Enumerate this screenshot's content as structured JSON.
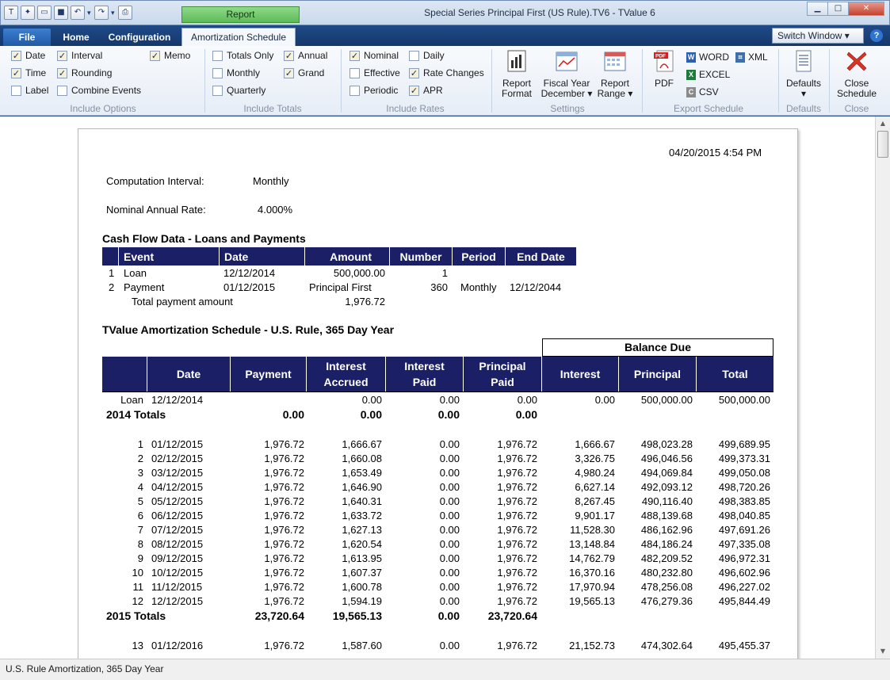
{
  "titlebar": {
    "report_tab": "Report",
    "window_title": "Special Series Principal First (US Rule).TV6 - TValue 6"
  },
  "tabs": {
    "file": "File",
    "home": "Home",
    "configuration": "Configuration",
    "amortization_schedule": "Amortization Schedule",
    "switch_window": "Switch Window ▾",
    "help": "?"
  },
  "ribbon": {
    "include_options": {
      "label": "Include Options",
      "date": "Date",
      "time": "Time",
      "label_opt": "Label",
      "interval": "Interval",
      "rounding": "Rounding",
      "combine_events": "Combine Events",
      "memo": "Memo"
    },
    "include_totals": {
      "label": "Include Totals",
      "totals_only": "Totals Only",
      "monthly": "Monthly",
      "quarterly": "Quarterly",
      "annual": "Annual",
      "grand": "Grand"
    },
    "include_rates": {
      "label": "Include Rates",
      "nominal": "Nominal",
      "effective": "Effective",
      "periodic": "Periodic",
      "daily": "Daily",
      "rate_changes": "Rate Changes",
      "apr": "APR"
    },
    "settings": {
      "label": "Settings",
      "report_format_1": "Report",
      "report_format_2": "Format",
      "fiscal_year_1": "Fiscal Year",
      "fiscal_year_2": "December ▾",
      "report_range_1": "Report",
      "report_range_2": "Range ▾"
    },
    "export": {
      "label": "Export Schedule",
      "pdf": "PDF",
      "word": "WORD",
      "excel": "EXCEL",
      "csv": "CSV",
      "xml": "XML"
    },
    "defaults": {
      "label": "Defaults",
      "button": "Defaults",
      "arrow": "▾"
    },
    "close": {
      "label": "Close",
      "button_1": "Close",
      "button_2": "Schedule"
    }
  },
  "report": {
    "timestamp": "04/20/2015   4:54 PM",
    "computation_interval_label": "Computation Interval:",
    "computation_interval_value": "Monthly",
    "nominal_rate_label": "Nominal Annual Rate:",
    "nominal_rate_value": "4.000%",
    "cashflow_title": "Cash Flow Data - Loans and Payments",
    "cashflow_headers": [
      "Event",
      "Date",
      "Amount",
      "Number",
      "Period",
      "End Date"
    ],
    "cashflow_rows": [
      [
        "1",
        "Loan",
        "12/12/2014",
        "500,000.00",
        "1",
        "",
        ""
      ],
      [
        "2",
        "Payment",
        "01/12/2015",
        "Principal First",
        "360",
        "Monthly",
        "12/12/2044"
      ]
    ],
    "total_payment_label": "Total payment amount",
    "total_payment_value": "1,976.72",
    "schedule_title": "TValue Amortization Schedule - U.S. Rule, 365 Day Year",
    "balance_due": "Balance Due",
    "schedule_headers": [
      "Date",
      "Payment",
      "Interest Accrued",
      "Interest Paid",
      "Principal Paid",
      "Interest",
      "Principal",
      "Total"
    ],
    "loan_row": [
      "Loan",
      "12/12/2014",
      "",
      "0.00",
      "0.00",
      "0.00",
      "0.00",
      "500,000.00",
      "500,000.00"
    ],
    "totals_2014": [
      "2014 Totals",
      "0.00",
      "0.00",
      "0.00",
      "0.00"
    ],
    "rows_2015": [
      [
        "1",
        "01/12/2015",
        "1,976.72",
        "1,666.67",
        "0.00",
        "1,976.72",
        "1,666.67",
        "498,023.28",
        "499,689.95"
      ],
      [
        "2",
        "02/12/2015",
        "1,976.72",
        "1,660.08",
        "0.00",
        "1,976.72",
        "3,326.75",
        "496,046.56",
        "499,373.31"
      ],
      [
        "3",
        "03/12/2015",
        "1,976.72",
        "1,653.49",
        "0.00",
        "1,976.72",
        "4,980.24",
        "494,069.84",
        "499,050.08"
      ],
      [
        "4",
        "04/12/2015",
        "1,976.72",
        "1,646.90",
        "0.00",
        "1,976.72",
        "6,627.14",
        "492,093.12",
        "498,720.26"
      ],
      [
        "5",
        "05/12/2015",
        "1,976.72",
        "1,640.31",
        "0.00",
        "1,976.72",
        "8,267.45",
        "490,116.40",
        "498,383.85"
      ],
      [
        "6",
        "06/12/2015",
        "1,976.72",
        "1,633.72",
        "0.00",
        "1,976.72",
        "9,901.17",
        "488,139.68",
        "498,040.85"
      ],
      [
        "7",
        "07/12/2015",
        "1,976.72",
        "1,627.13",
        "0.00",
        "1,976.72",
        "11,528.30",
        "486,162.96",
        "497,691.26"
      ],
      [
        "8",
        "08/12/2015",
        "1,976.72",
        "1,620.54",
        "0.00",
        "1,976.72",
        "13,148.84",
        "484,186.24",
        "497,335.08"
      ],
      [
        "9",
        "09/12/2015",
        "1,976.72",
        "1,613.95",
        "0.00",
        "1,976.72",
        "14,762.79",
        "482,209.52",
        "496,972.31"
      ],
      [
        "10",
        "10/12/2015",
        "1,976.72",
        "1,607.37",
        "0.00",
        "1,976.72",
        "16,370.16",
        "480,232.80",
        "496,602.96"
      ],
      [
        "11",
        "11/12/2015",
        "1,976.72",
        "1,600.78",
        "0.00",
        "1,976.72",
        "17,970.94",
        "478,256.08",
        "496,227.02"
      ],
      [
        "12",
        "12/12/2015",
        "1,976.72",
        "1,594.19",
        "0.00",
        "1,976.72",
        "19,565.13",
        "476,279.36",
        "495,844.49"
      ]
    ],
    "totals_2015": [
      "2015 Totals",
      "23,720.64",
      "19,565.13",
      "0.00",
      "23,720.64"
    ],
    "rows_2016": [
      [
        "13",
        "01/12/2016",
        "1,976.72",
        "1,587.60",
        "0.00",
        "1,976.72",
        "21,152.73",
        "474,302.64",
        "495,455.37"
      ]
    ]
  },
  "status": "U.S. Rule Amortization, 365 Day Year",
  "colors": {
    "header_navy": "#1a1f66",
    "ribbon_blue": "#1e4a88",
    "report_tab_green": "#5dbb57"
  }
}
